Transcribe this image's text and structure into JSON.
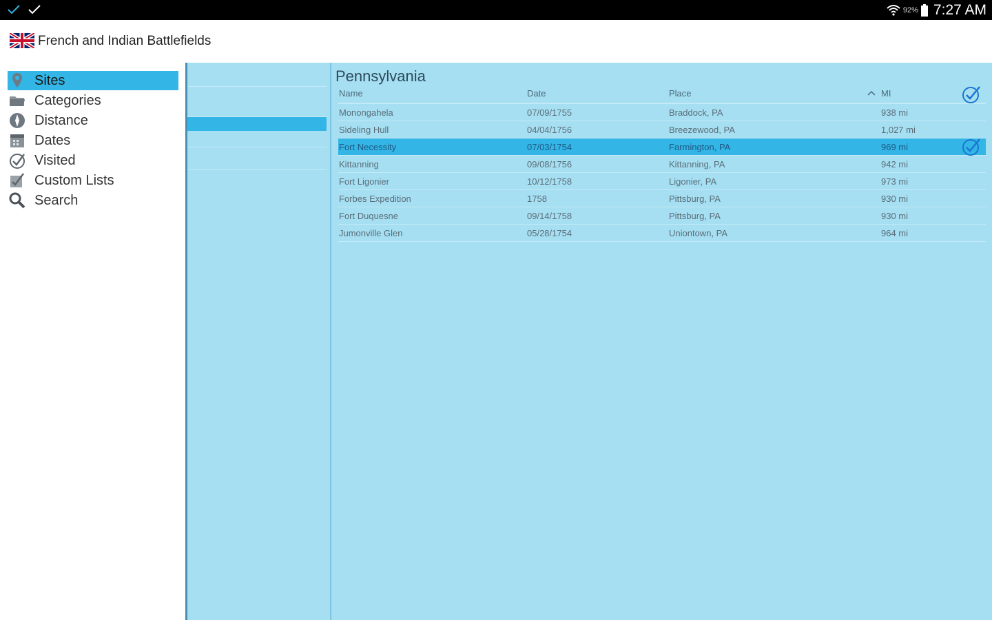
{
  "status_bar": {
    "notification_icons": [
      "check-icon",
      "check-icon"
    ],
    "battery_percent": "92%",
    "time": "7:27 AM"
  },
  "app": {
    "title": "French and Indian Battlefields",
    "flag_icon": "union-jack-flag-icon"
  },
  "nav": {
    "items": [
      {
        "label": "Sites",
        "icon": "map-pin-icon",
        "active": true
      },
      {
        "label": "Categories",
        "icon": "folder-icon",
        "active": false
      },
      {
        "label": "Distance",
        "icon": "compass-icon",
        "active": false
      },
      {
        "label": "Dates",
        "icon": "calendar-icon",
        "active": false
      },
      {
        "label": "Visited",
        "icon": "check-circle-icon",
        "active": false
      },
      {
        "label": "Custom Lists",
        "icon": "checklist-icon",
        "active": false
      },
      {
        "label": "Search",
        "icon": "search-icon",
        "active": false
      }
    ]
  },
  "main": {
    "region": "Pennsylvania",
    "columns": {
      "name": "Name",
      "date": "Date",
      "place": "Place",
      "mi": "MI"
    },
    "sort_indicator": "sort-ascending-icon",
    "rows": [
      {
        "name": "Monongahela",
        "date": "07/09/1755",
        "place": "Braddock, PA",
        "mi": "938 mi",
        "selected": false
      },
      {
        "name": "Sideling Hull",
        "date": "04/04/1756",
        "place": "Breezewood, PA",
        "mi": "1,027 mi",
        "selected": false
      },
      {
        "name": "Fort Necessity",
        "date": "07/03/1754",
        "place": "Farmington, PA",
        "mi": "969 mi",
        "selected": true
      },
      {
        "name": "Kittanning",
        "date": "09/08/1756",
        "place": "Kittanning, PA",
        "mi": "942 mi",
        "selected": false
      },
      {
        "name": "Fort Ligonier",
        "date": "10/12/1758",
        "place": "Ligonier, PA",
        "mi": "973 mi",
        "selected": false
      },
      {
        "name": "Forbes Expedition",
        "date": "1758",
        "place": "Pittsburg, PA",
        "mi": "930 mi",
        "selected": false
      },
      {
        "name": "Fort Duquesne",
        "date": "09/14/1758",
        "place": "Pittsburg, PA",
        "mi": "930 mi",
        "selected": false
      },
      {
        "name": "Jumonville Glen",
        "date": "05/28/1754",
        "place": "Uniontown, PA",
        "mi": "964 mi",
        "selected": false
      }
    ]
  },
  "colors": {
    "accent": "#33b5e5",
    "pane_background": "#a6dff2",
    "status_bar": "#000000"
  }
}
